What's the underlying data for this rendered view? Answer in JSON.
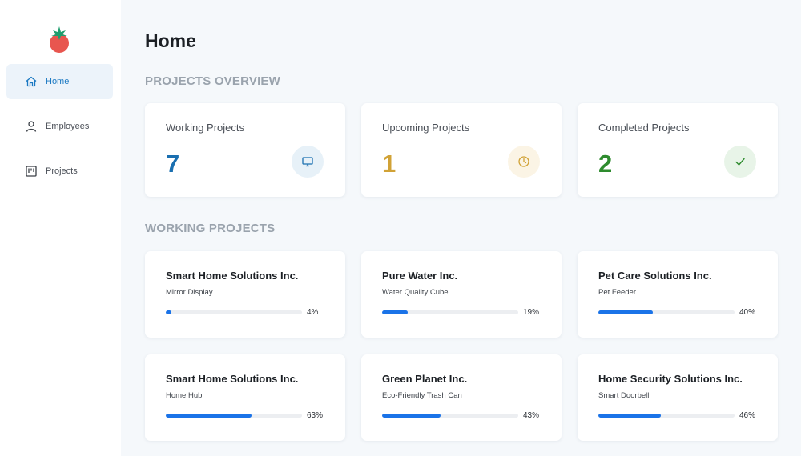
{
  "sidebar": {
    "items": [
      {
        "label": "Home",
        "icon": "home-icon",
        "active": true
      },
      {
        "label": "Employees",
        "icon": "user-icon",
        "active": false
      },
      {
        "label": "Projects",
        "icon": "board-icon",
        "active": false
      }
    ]
  },
  "page": {
    "title": "Home"
  },
  "overview": {
    "title": "PROJECTS OVERVIEW",
    "cards": [
      {
        "label": "Working Projects",
        "value": "7",
        "color": "#1a6fb0",
        "icon": "monitor-icon",
        "icon_bg": "#e7f1f8"
      },
      {
        "label": "Upcoming Projects",
        "value": "1",
        "color": "#d1a236",
        "icon": "clock-icon",
        "icon_bg": "#fbf4e5"
      },
      {
        "label": "Completed Projects",
        "value": "2",
        "color": "#2e8b2e",
        "icon": "check-icon",
        "icon_bg": "#e8f4e8"
      }
    ]
  },
  "working": {
    "title": "WORKING PROJECTS",
    "projects": [
      {
        "client": "Smart Home Solutions Inc.",
        "product": "Mirror Display",
        "progress_label": "4%",
        "progress": 4
      },
      {
        "client": "Pure Water Inc.",
        "product": "Water Quality Cube",
        "progress_label": "19%",
        "progress": 19
      },
      {
        "client": "Pet Care Solutions Inc.",
        "product": "Pet Feeder",
        "progress_label": "40%",
        "progress": 40
      },
      {
        "client": "Smart Home Solutions Inc.",
        "product": "Home Hub",
        "progress_label": "63%",
        "progress": 63
      },
      {
        "client": "Green Planet Inc.",
        "product": "Eco-Friendly Trash Can",
        "progress_label": "43%",
        "progress": 43
      },
      {
        "client": "Home Security Solutions Inc.",
        "product": "Smart Doorbell",
        "progress_label": "46%",
        "progress": 46
      }
    ]
  },
  "colors": {
    "accent": "#1a78c2",
    "progress": "#1a73e8",
    "logo": "#e8564f",
    "logo_leaves": "#1f9e6e"
  }
}
